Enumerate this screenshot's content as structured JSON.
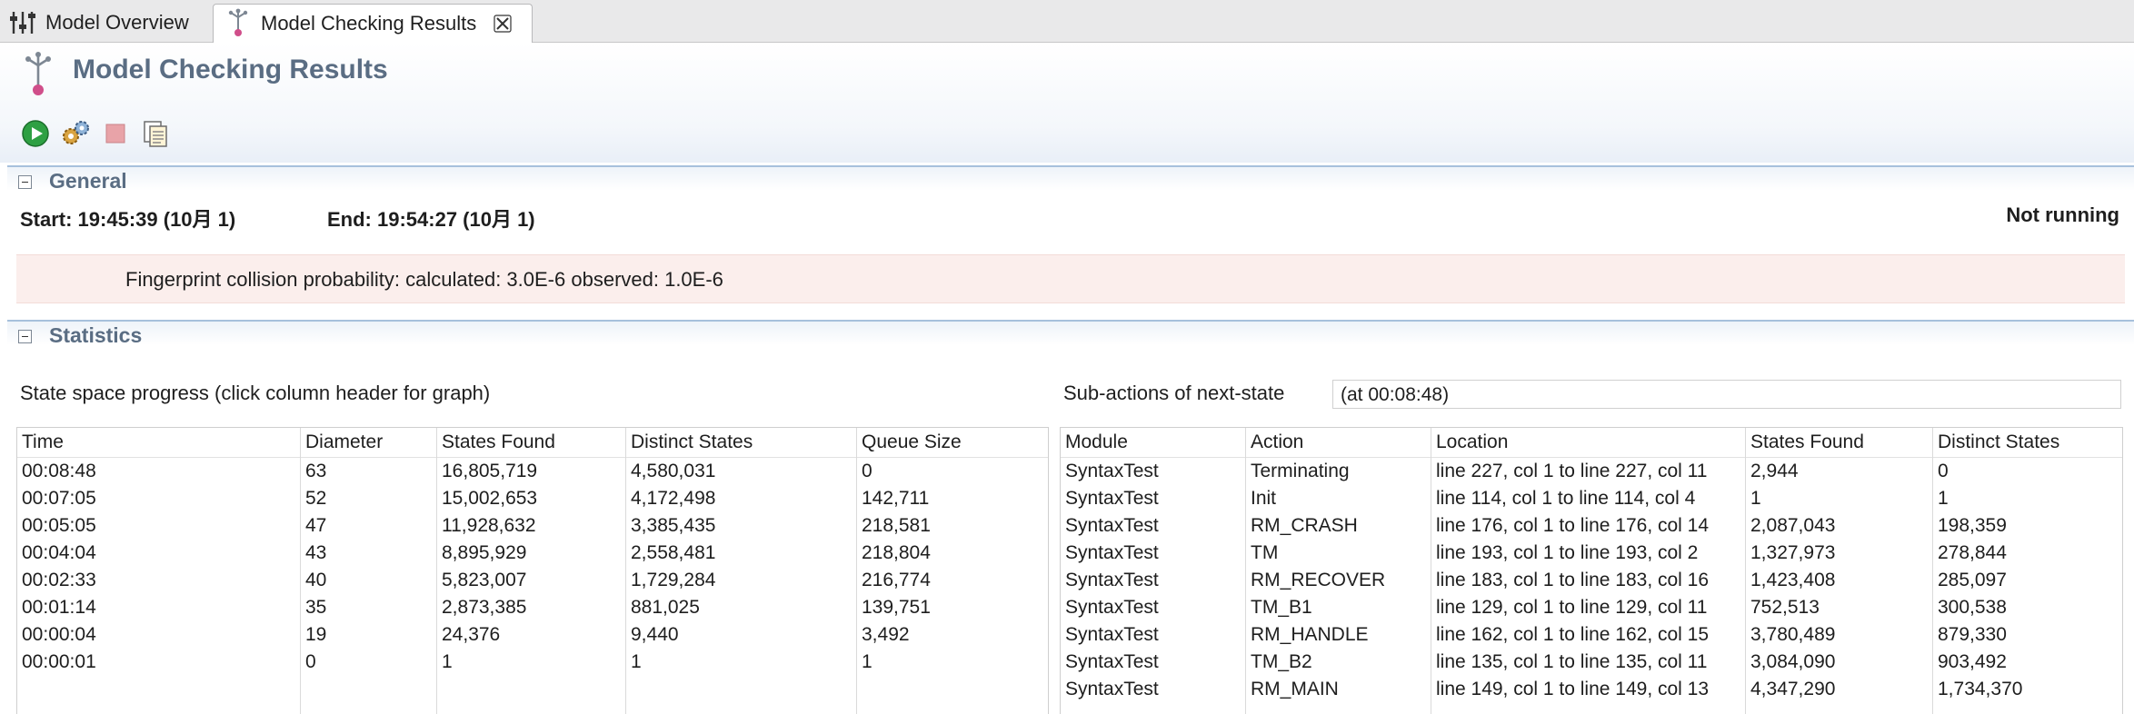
{
  "tabs": [
    {
      "label": "Model Overview",
      "icon": "sliders-icon"
    },
    {
      "label": "Model Checking Results",
      "icon": "model-check-icon",
      "active": true
    }
  ],
  "page": {
    "title": "Model Checking Results"
  },
  "toolbar": {
    "buttons": [
      "run-icon",
      "gears-icon",
      "stop-icon",
      "copy-report-icon"
    ]
  },
  "general": {
    "section_label": "General",
    "start": "Start: 19:45:39 (10月 1)",
    "end": "End: 19:54:27 (10月 1)",
    "status": "Not running",
    "fingerprint": "Fingerprint collision probability: calculated: 3.0E-6  observed: 1.0E-6"
  },
  "statistics": {
    "section_label": "Statistics",
    "progress_label": "State space progress (click column header for graph)",
    "subactions_label": "Sub-actions of next-state",
    "subactions_time": "(at 00:08:48)",
    "progress_table": {
      "columns": [
        "Time",
        "Diameter",
        "States Found",
        "Distinct States",
        "Queue Size"
      ],
      "rows": [
        [
          "00:08:48",
          "63",
          "16,805,719",
          "4,580,031",
          "0"
        ],
        [
          "00:07:05",
          "52",
          "15,002,653",
          "4,172,498",
          "142,711"
        ],
        [
          "00:05:05",
          "47",
          "11,928,632",
          "3,385,435",
          "218,581"
        ],
        [
          "00:04:04",
          "43",
          "8,895,929",
          "2,558,481",
          "218,804"
        ],
        [
          "00:02:33",
          "40",
          "5,823,007",
          "1,729,284",
          "216,774"
        ],
        [
          "00:01:14",
          "35",
          "2,873,385",
          "881,025",
          "139,751"
        ],
        [
          "00:00:04",
          "19",
          "24,376",
          "9,440",
          "3,492"
        ],
        [
          "00:00:01",
          "0",
          "1",
          "1",
          "1"
        ]
      ]
    },
    "subactions_table": {
      "columns": [
        "Module",
        "Action",
        "Location",
        "States Found",
        "Distinct States"
      ],
      "rows": [
        [
          "SyntaxTest",
          "Terminating",
          "line 227, col 1 to line 227, col 11",
          "2,944",
          "0"
        ],
        [
          "SyntaxTest",
          "Init",
          "line 114, col 1 to line 114, col 4",
          "1",
          "1"
        ],
        [
          "SyntaxTest",
          "RM_CRASH",
          "line 176, col 1 to line 176, col 14",
          "2,087,043",
          "198,359"
        ],
        [
          "SyntaxTest",
          "TM",
          "line 193, col 1 to line 193, col 2",
          "1,327,973",
          "278,844"
        ],
        [
          "SyntaxTest",
          "RM_RECOVER",
          "line 183, col 1 to line 183, col 16",
          "1,423,408",
          "285,097"
        ],
        [
          "SyntaxTest",
          "TM_B1",
          "line 129, col 1 to line 129, col 11",
          "752,513",
          "300,538"
        ],
        [
          "SyntaxTest",
          "RM_HANDLE",
          "line 162, col 1 to line 162, col 15",
          "3,780,489",
          "879,330"
        ],
        [
          "SyntaxTest",
          "TM_B2",
          "line 135, col 1 to line 135, col 11",
          "3,084,090",
          "903,492"
        ],
        [
          "SyntaxTest",
          "RM_MAIN",
          "line 149, col 1 to line 149, col 13",
          "4,347,290",
          "1,734,370"
        ]
      ]
    }
  }
}
